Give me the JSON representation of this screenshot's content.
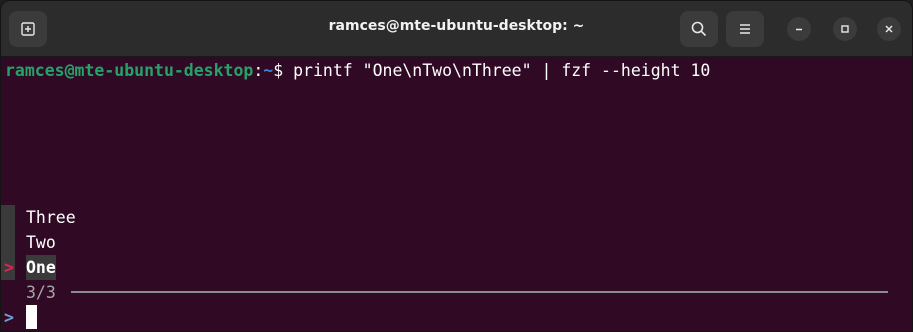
{
  "window": {
    "title": "ramces@mte-ubuntu-desktop: ~"
  },
  "titlebar": {
    "new_tab_icon": "new-tab-icon",
    "search_icon": "search-icon",
    "menu_icon": "hamburger-menu-icon",
    "minimize_icon": "minimize-icon",
    "maximize_icon": "maximize-icon",
    "close_icon": "close-icon"
  },
  "terminal": {
    "prompt_user": "ramces@mte-ubuntu-desktop",
    "prompt_colon": ":",
    "prompt_path": "~",
    "prompt_dollar": "$",
    "command": " printf \"One\\nTwo\\nThree\" | fzf --height 10",
    "fzf": {
      "items": [
        "Three",
        "Two",
        "One"
      ],
      "selected_index": 2,
      "pointer": ">",
      "count": "3/3",
      "query_prompt": ">",
      "query": ""
    }
  },
  "colors": {
    "background": "#300a24",
    "user": "#26a269",
    "path": "#3e7fd0",
    "pointer": "#e0245a"
  }
}
